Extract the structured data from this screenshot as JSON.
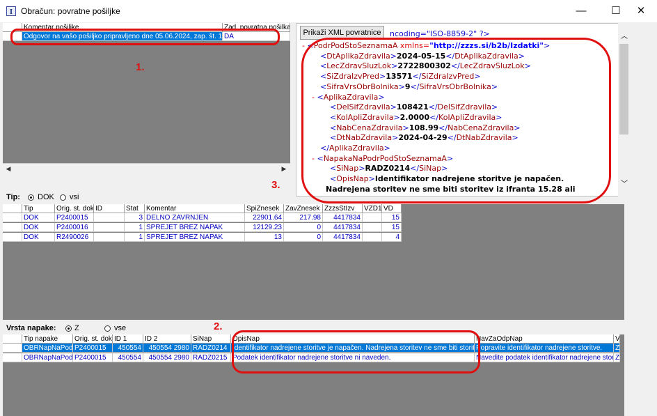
{
  "window": {
    "title": "Obračun: povratne pošiljke",
    "minimize": "—",
    "maximize": "☐",
    "close": "✕"
  },
  "top_grid": {
    "headers": [
      "Komentar pošiljke",
      "Zad. povratna pošilka"
    ],
    "row": {
      "comment": "Odgovor na vašo pošiljko pripravljeno dne 05.06.2024, zap. št. 1.",
      "flag": "DA"
    }
  },
  "xml_button": "Prikaži XML povratnice",
  "xml": {
    "header_fragment": "ncoding=\"ISO-8859-2\" ?>",
    "lines": [
      {
        "indent": 0,
        "marker": "-",
        "open": "PodrPodStoSeznamaA",
        "attr": "xmlns=",
        "attr_value": "\"http://zzzs.si/b2b/Izdatki\"",
        "close_bracket": ">"
      },
      {
        "indent": 1,
        "tag": "DtAplikaZdravila",
        "value": "2024-05-15"
      },
      {
        "indent": 1,
        "tag": "LecZdravSluzLok",
        "value": "2722800302"
      },
      {
        "indent": 1,
        "tag": "SiZdraIzvPred",
        "value": "13571"
      },
      {
        "indent": 1,
        "tag": "SifraVrsObrBolnika",
        "value": "9"
      },
      {
        "indent": 1,
        "marker": "-",
        "open": "AplikaZdravila"
      },
      {
        "indent": 2,
        "tag": "DelSifZdravila",
        "value": "108421"
      },
      {
        "indent": 2,
        "tag": "KolApliZdravila",
        "value": "2.0000"
      },
      {
        "indent": 2,
        "tag": "NabCenaZdravila",
        "value": "108.99"
      },
      {
        "indent": 2,
        "tag": "DtNabZdravila",
        "value": "2024-04-29"
      },
      {
        "indent": 1,
        "closeonly": "AplikaZdravila"
      },
      {
        "indent": 1,
        "marker": "-",
        "open": "NapakaNaPodrPodStoSeznamaA"
      },
      {
        "indent": 2,
        "tag": "SiNap",
        "value": "RADZ0214"
      },
      {
        "indent": 2,
        "openwithtext": "OpisNap",
        "value": "Identifikator nadrejene storitve je napačen."
      },
      {
        "indent": 2,
        "textonly": "Nadrejena storitev ne sme biti storitev iz ifranta 15.28 ali"
      }
    ]
  },
  "annotations": {
    "one": "1.",
    "two": "2.",
    "three": "3."
  },
  "tip": {
    "label": "Tip:",
    "opt1": "DOK",
    "opt2": "vsi"
  },
  "mid_grid": {
    "headers": [
      "Tip",
      "Orig. st. dok.",
      "ID",
      "Stat",
      "Komentar",
      "SpiZnesek",
      "ZavZnesek",
      "ZzzsStIzv",
      "VZD1",
      "VD"
    ],
    "rows": [
      [
        "DOK",
        "P2400015",
        "",
        "3",
        "DELNO ZAVRNJEN",
        "22901.64",
        "217.98",
        "4417834",
        "",
        "15"
      ],
      [
        "DOK",
        "P2400016",
        "",
        "1",
        "SPREJET BREZ NAPAK",
        "12129.23",
        "0",
        "4417834",
        "",
        "15"
      ],
      [
        "DOK",
        "R2490026",
        "",
        "1",
        "SPREJET BREZ NAPAK",
        "13",
        "0",
        "4417834",
        "",
        "4"
      ]
    ]
  },
  "vrsta": {
    "label": "Vrsta napake:",
    "opt1": "Z",
    "opt2": "vse"
  },
  "bottom_grid": {
    "headers": [
      "Tip napake",
      "Orig. st. dok.",
      "ID 1",
      "ID 2",
      "SiNap",
      "OpisNap",
      "NavZaOdpNap",
      "V"
    ],
    "rows": [
      [
        "OBRNapNaPodrl",
        "P2400015",
        "450554",
        "450554 2980",
        "RADZ0214",
        "Identifikator nadrejene storitve je napačen. Nadrejena storitev ne sme biti storitev iz š",
        "Popravite identifikator nadrejene storitve.",
        "Z"
      ],
      [
        "OBRNapNaPodrl",
        "P2400015",
        "450554",
        "450554 2980",
        "RADZ0215",
        "Podatek identifikator nadrejene storitve ni naveden.",
        "Navedite podatek identifikator nadrejene storitve",
        "Z"
      ]
    ]
  }
}
